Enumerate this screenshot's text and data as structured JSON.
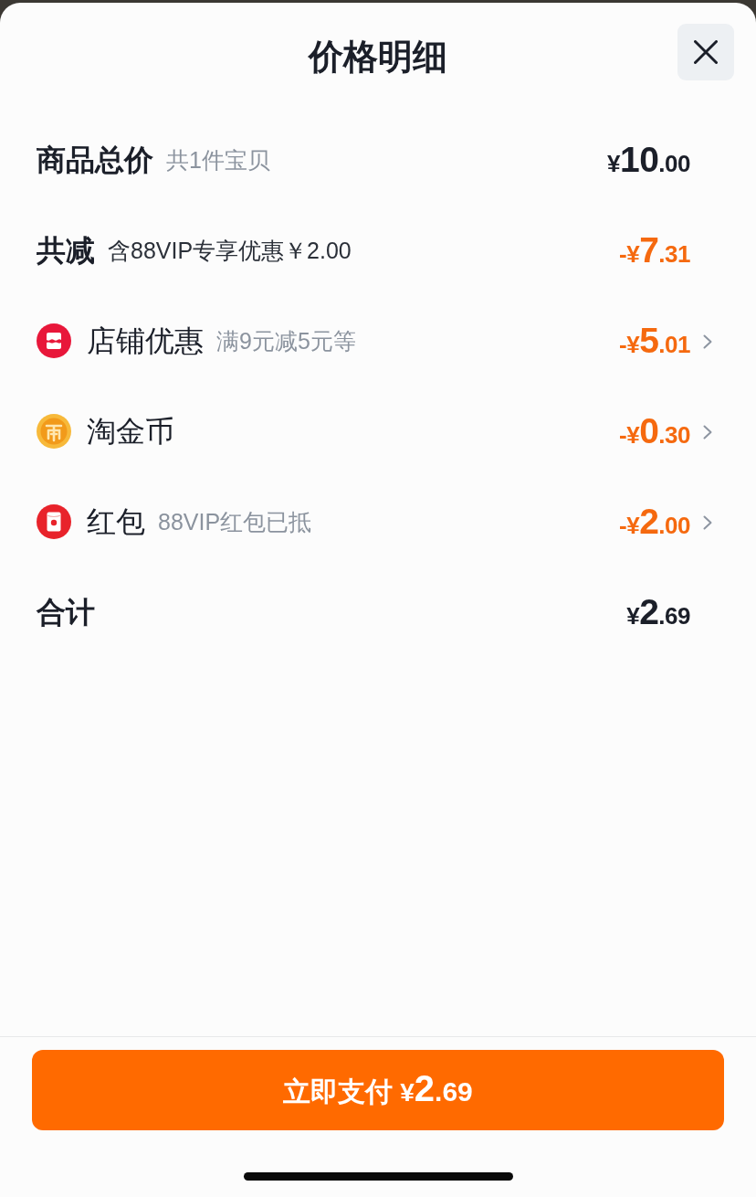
{
  "sheet": {
    "title": "价格明细"
  },
  "rows": [
    {
      "kind": "subtotal",
      "label": "商品总价",
      "note": "共1件宝贝",
      "amount": {
        "prefix": "¥",
        "whole": "10",
        "fraction": ".00"
      }
    },
    {
      "kind": "savings",
      "label": "共减",
      "note": "含88VIP专享优惠￥2.00",
      "amount": {
        "prefix": "-¥",
        "whole": "7",
        "fraction": ".31"
      }
    },
    {
      "kind": "shop",
      "label": "店铺优惠",
      "note": "满9元减5元等",
      "amount": {
        "prefix": "-¥",
        "whole": "5",
        "fraction": ".01"
      }
    },
    {
      "kind": "coin",
      "label": "淘金币",
      "amount": {
        "prefix": "-¥",
        "whole": "0",
        "fraction": ".30"
      }
    },
    {
      "kind": "redpacket",
      "label": "红包",
      "note": "88VIP红包已抵",
      "amount": {
        "prefix": "-¥",
        "whole": "2",
        "fraction": ".00"
      }
    },
    {
      "kind": "total",
      "label": "合计",
      "amount": {
        "prefix": "¥",
        "whole": "2",
        "fraction": ".69"
      }
    }
  ],
  "pay_button": {
    "label": "立即支付",
    "amount": {
      "prefix": "¥",
      "whole": "2",
      "fraction": ".69"
    }
  }
}
